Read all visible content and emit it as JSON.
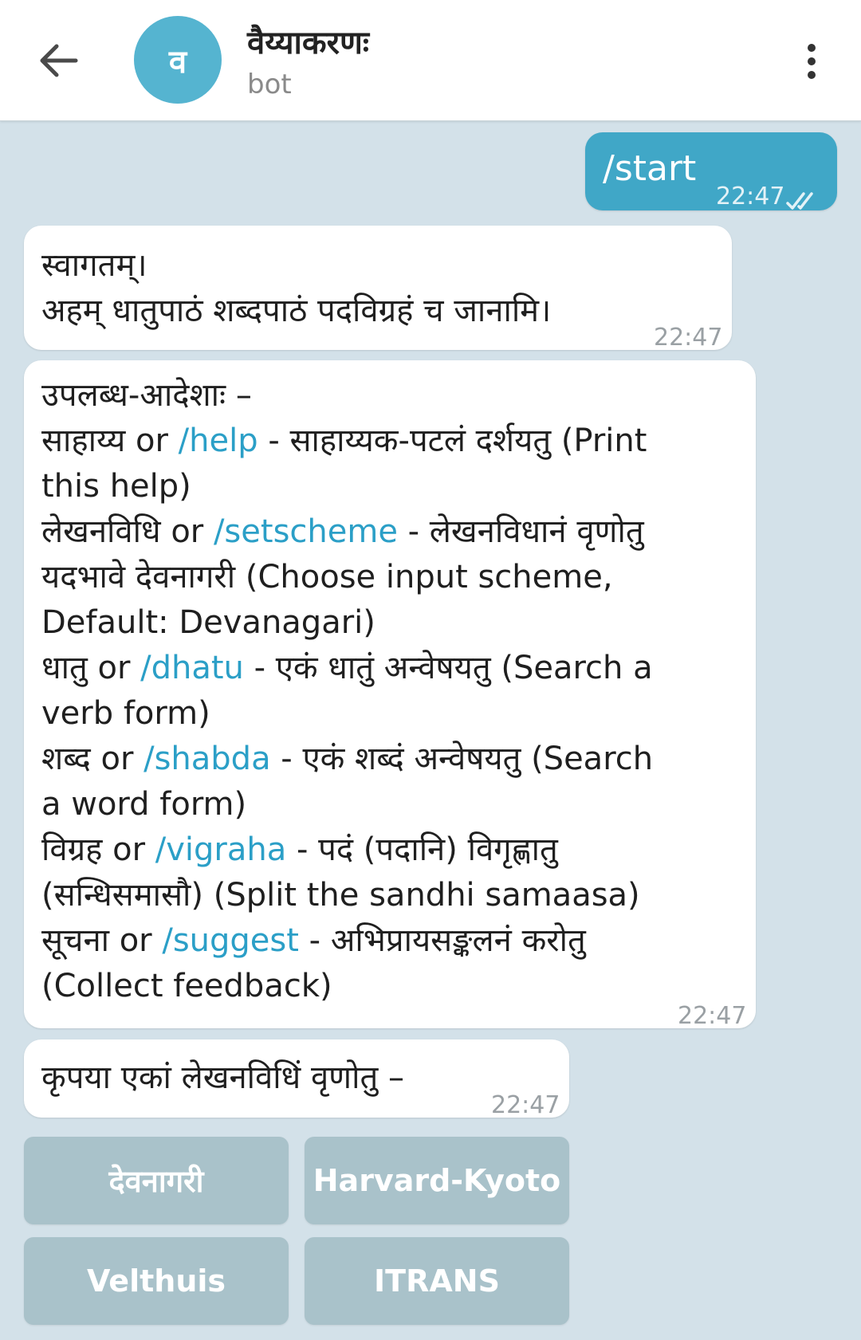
{
  "header": {
    "title": "वैय्याकरणः",
    "subtitle": "bot",
    "avatar_letter": "व"
  },
  "messages": {
    "outgoing_start": {
      "text": "/start",
      "time": "22:47"
    },
    "welcome": {
      "line1": "स्वागतम्।",
      "line2": "अहम् धातुपाठं शब्दपाठं पदविग्रहं च जानामि।",
      "time": "22:47"
    },
    "commands": {
      "heading": "उपलब्ध-आदेशाः –",
      "help_pre": "साहाय्य or ",
      "help_cmd": "/help",
      "help_post": " - साहाय्यक-पटलं दर्शयतु (Print",
      "help_cont": "this help)",
      "setscheme_pre": "लेखनविधि or ",
      "setscheme_cmd": "/setscheme",
      "setscheme_post": " - लेखनविधानं वृणोतु",
      "setscheme_cont1": "यदभावे देवनागरी (Choose input scheme,",
      "setscheme_cont2": "Default: Devanagari)",
      "dhatu_pre": "धातु or ",
      "dhatu_cmd": "/dhatu",
      "dhatu_post": " - एकं धातुं अन्वेषयतु (Search a",
      "dhatu_cont": "verb form)",
      "shabda_pre": "शब्द or ",
      "shabda_cmd": "/shabda",
      "shabda_post": " - एकं शब्दं अन्वेषयतु (Search",
      "shabda_cont": "a word form)",
      "vigraha_pre": "विग्रह or ",
      "vigraha_cmd": "/vigraha",
      "vigraha_post": " - पदं (पदानि) विगृह्णातु",
      "vigraha_cont": "(सन्धिसमासौ) (Split the sandhi samaasa)",
      "suggest_pre": "सूचना or ",
      "suggest_cmd": "/suggest",
      "suggest_post": " - अभिप्रायसङ्कलनं करोतु",
      "suggest_cont": "(Collect feedback)",
      "time": "22:47"
    },
    "choose": {
      "text": "कृपया एकां लेखनविधिं वृणोतु –",
      "time": "22:47"
    }
  },
  "keyboard": {
    "devanagari": "देवनागरी",
    "harvard_kyoto": "Harvard-Kyoto",
    "velthuis": "Velthuis",
    "itrans": "ITRANS"
  },
  "colors": {
    "background": "#d3e1e9",
    "outgoing_bubble": "#40a7c7",
    "link": "#2b9fc7",
    "keyboard_button": "#a9c2ca",
    "avatar": "#55b4d0"
  }
}
